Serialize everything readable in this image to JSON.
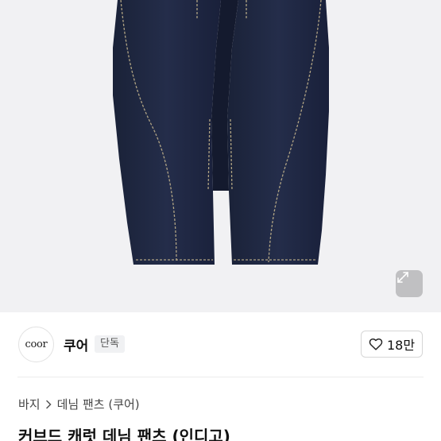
{
  "hero": {
    "image_alt": "indigo curved denim pants"
  },
  "brand": {
    "logo_text": "coor",
    "name": "쿠어",
    "badge": "단독"
  },
  "like": {
    "count": "18만"
  },
  "breadcrumb": {
    "category": "바지",
    "subcategory": "데님 팬츠 (쿠어)"
  },
  "product": {
    "title": "커브드 캐럿 데님 팬츠 (인디고)"
  },
  "colors": {
    "denim": "#1e2640",
    "stitch": "#c9b98f",
    "background": "#f1f1f3"
  }
}
